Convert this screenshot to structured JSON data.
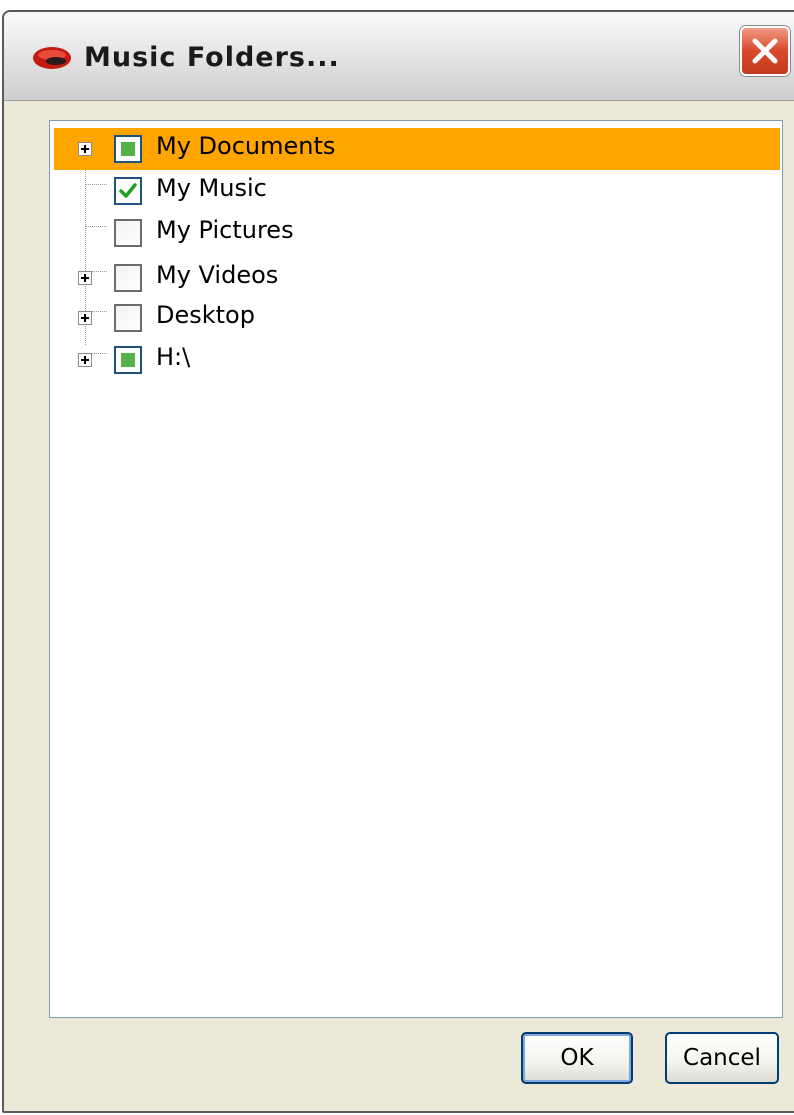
{
  "window": {
    "title": "Music Folders..."
  },
  "tree": {
    "items": [
      {
        "label": "My Documents",
        "check": "partial",
        "expandable": true,
        "selected": true
      },
      {
        "label": "My Music",
        "check": "checked",
        "expandable": false,
        "selected": false
      },
      {
        "label": "My Pictures",
        "check": "unchecked",
        "expandable": false,
        "selected": false
      },
      {
        "label": "My Videos",
        "check": "unchecked",
        "expandable": true,
        "selected": false
      },
      {
        "label": "Desktop",
        "check": "unchecked",
        "expandable": true,
        "selected": false
      },
      {
        "label": "H:\\",
        "check": "partial",
        "expandable": true,
        "selected": false
      }
    ]
  },
  "buttons": {
    "ok_label": "OK",
    "cancel_label": "Cancel"
  },
  "colors": {
    "selection": "#ffa500",
    "partial_fill": "#55b24a",
    "check_mark": "#21a121",
    "close_button": "#d9482b"
  }
}
